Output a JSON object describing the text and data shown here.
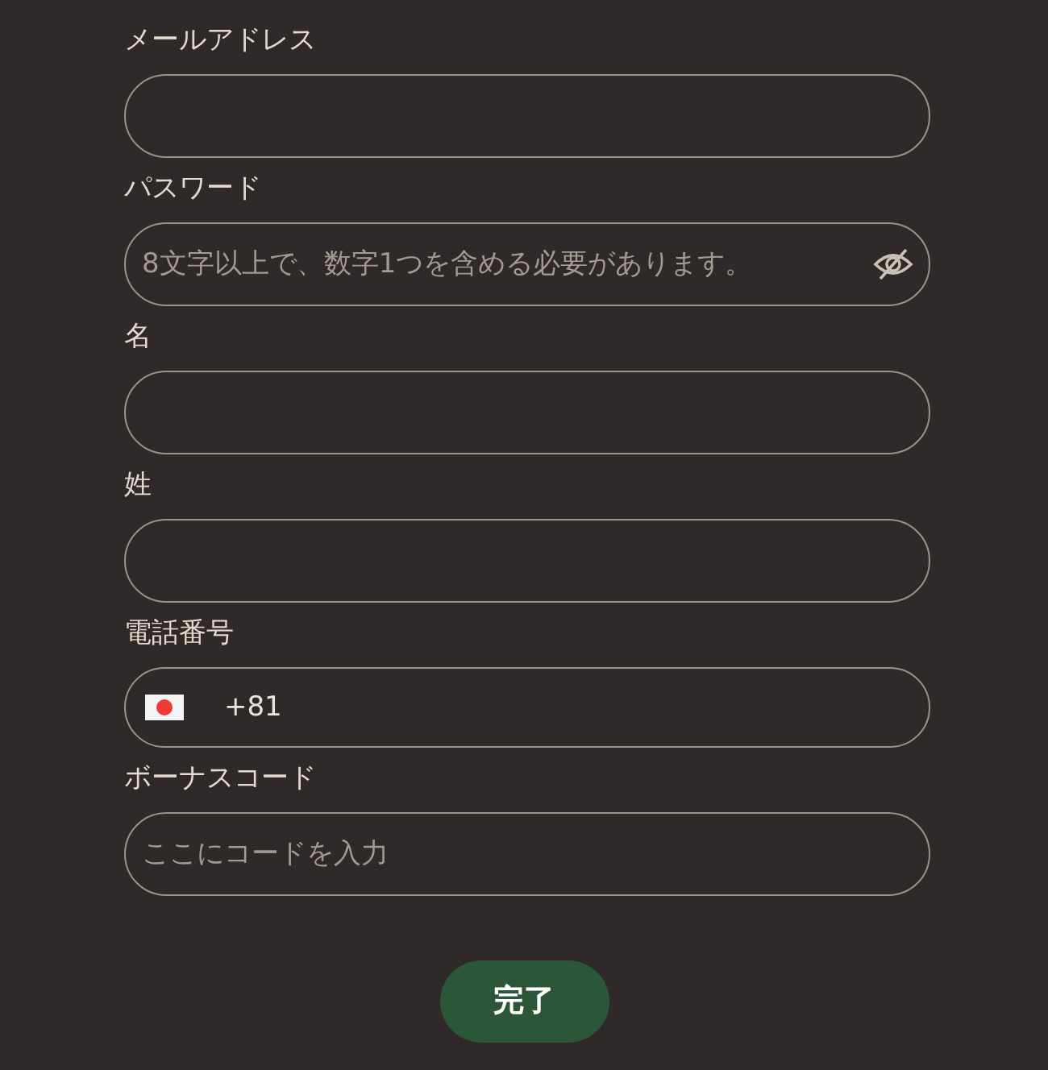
{
  "fields": [
    {
      "kind": "text",
      "label": "メールアドレス"
    },
    {
      "kind": "password",
      "label": "パスワード",
      "placeholder": "8文字以上で、数字1つを含める必要があります。"
    },
    {
      "kind": "text",
      "label": "名"
    },
    {
      "kind": "text",
      "label": "姓"
    },
    {
      "kind": "phone",
      "label": "電話番号",
      "value": "+81"
    },
    {
      "kind": "text",
      "label": "ボーナスコード",
      "placeholder": "ここにコードを入力"
    }
  ],
  "submit_button": "完了"
}
